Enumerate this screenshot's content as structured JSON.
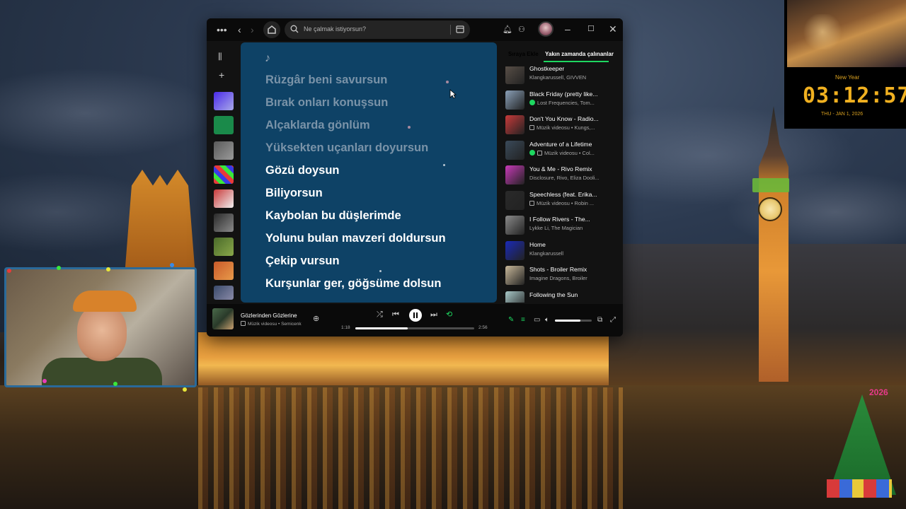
{
  "spotify": {
    "search_placeholder": "Ne çalmak istiyorsun?",
    "lyrics": {
      "lines": [
        {
          "text": "Rüzgâr beni savursun",
          "state": "past"
        },
        {
          "text": "Bırak onları konuşsun",
          "state": "past"
        },
        {
          "text": "Alçaklarda gönlüm",
          "state": "past"
        },
        {
          "text": "Yüksekten uçanları doyursun",
          "state": "past"
        },
        {
          "text": "Gözü doysun",
          "state": "now"
        },
        {
          "text": "Biliyorsun",
          "state": "now"
        },
        {
          "text": "Kaybolan bu düşlerimde",
          "state": "now"
        },
        {
          "text": "Yolunu bulan mavzeri doldursun",
          "state": "now"
        },
        {
          "text": "Çekip vursun",
          "state": "now"
        },
        {
          "text": "Kurşunlar ger, göğsüme dolsun",
          "state": "now"
        }
      ]
    },
    "right_panel": {
      "tabs": [
        {
          "label": "Sıraya Ekle",
          "active": false
        },
        {
          "label": "Yakın zamanda çalınanlar",
          "active": true
        }
      ],
      "items": [
        {
          "title": "Ghostkeeper",
          "subtitle": "Klangkarussell, GIVVEN",
          "badge": "none",
          "color": "#5a5048"
        },
        {
          "title": "Black Friday (pretty like...",
          "subtitle": "Lost Frequencies, Tom...",
          "badge": "download",
          "color": "#8aa0b8"
        },
        {
          "title": "Don't You Know - Radio...",
          "subtitle": "Müzik videosu • Kungs,...",
          "badge": "video",
          "color": "#c83a3a"
        },
        {
          "title": "Adventure of a Lifetime",
          "subtitle": "Müzik videosu • Col...",
          "badge": "download-video",
          "color": "#3a4a5a"
        },
        {
          "title": "You & Me - Rivo Remix",
          "subtitle": "Disclosure, Rivo, Eliza Dooli...",
          "badge": "none",
          "color": "#c83ab8"
        },
        {
          "title": "Speechless (feat. Erika...",
          "subtitle": "Müzik videosu • Robin ...",
          "badge": "video",
          "color": "#2a2a2a"
        },
        {
          "title": "I Follow Rivers - The...",
          "subtitle": "Lykke Li, The Magician",
          "badge": "none",
          "color": "#8a8a8a"
        },
        {
          "title": "Home",
          "subtitle": "Klangkarussell",
          "badge": "none",
          "color": "#1a2ab8"
        },
        {
          "title": "Shots - Broiler Remix",
          "subtitle": "Imagine Dragons, Broiler",
          "badge": "none",
          "color": "#c8b89a"
        },
        {
          "title": "Following the Sun",
          "subtitle": "",
          "badge": "none",
          "color": "#a8c8c8"
        }
      ]
    },
    "now_playing": {
      "title": "Gözlerinden Gözlerine",
      "subtitle": "Müzik videosu • Semicenk",
      "elapsed": "1:18",
      "duration": "2:56",
      "progress": 0.44,
      "volume": 0.7
    }
  },
  "clock_widget": {
    "label": "New Year",
    "time": "03:12:57",
    "date": "THU - JAN 1, 2026"
  },
  "tree_year": "2026",
  "colors": {
    "lyrics_bg": "#0e4266",
    "spotify_green": "#1ed760",
    "window_bg": "#121212"
  }
}
